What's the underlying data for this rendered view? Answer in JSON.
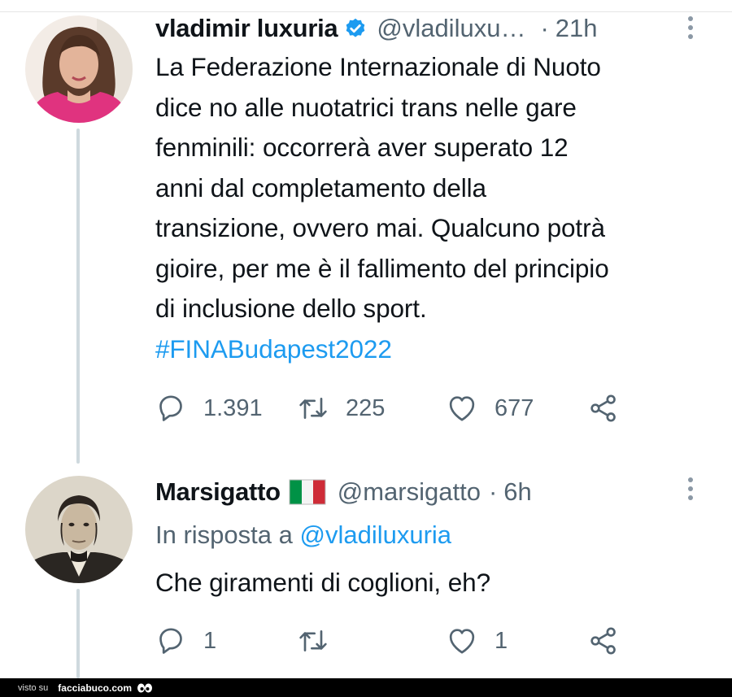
{
  "tweet1": {
    "author_name": "vladimir luxuria",
    "handle": "@vladiluxu…",
    "separator": "·",
    "time": "21h",
    "verified_icon": "verified-badge-icon",
    "text_lines": [
      "La Federazione Internazionale di Nuoto",
      "dice no alle nuotatrici trans nelle gare",
      "fenminili: occorrerà aver superato 12",
      "anni dal completamento della",
      "transizione, ovvero mai. Qualcuno potrà",
      "gioire, per me è il fallimento del principio",
      "di inclusione dello sport."
    ],
    "hashtag": "#FINABudapest2022",
    "replies": "1.391",
    "retweets": "225",
    "likes": "677"
  },
  "tweet2": {
    "author_name": "Marsigatto",
    "flag_icon": "italy-flag-icon",
    "handle": "@marsigatto",
    "separator": "·",
    "time": "6h",
    "reply_prefix": "In risposta a",
    "reply_mention": "@vladiluxuria",
    "text": "Che giramenti di coglioni, eh?",
    "replies": "1",
    "retweets": "",
    "likes": "1"
  },
  "footer": {
    "visto_su": "visto su",
    "brand": "facciabuco.com"
  },
  "colors": {
    "accent": "#1d9bf0",
    "muted": "#536471",
    "thread_line": "#cfd9de"
  }
}
